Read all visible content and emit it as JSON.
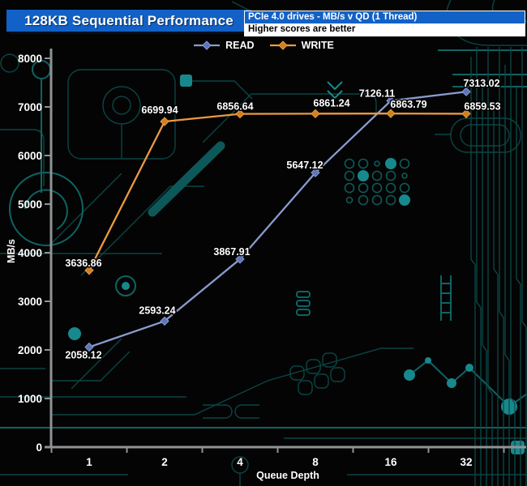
{
  "header": {
    "title": "128KB Sequential Performance",
    "subtitle": "PCIe 4.0 drives - MB/s v QD (1 Thread)",
    "note": "Higher scores are better"
  },
  "colors": {
    "header_blue": "#1261c7",
    "axis": "#8f9396",
    "tick_text": "#ffffff",
    "circuit_dim": "#0b4a4a",
    "circuit_bright": "#17898c"
  },
  "chart_data": {
    "type": "line",
    "title": "128KB Sequential Performance",
    "xlabel": "Queue Depth",
    "ylabel": "MB/s",
    "categories": [
      "1",
      "2",
      "4",
      "8",
      "16",
      "32"
    ],
    "yticks": [
      0,
      1000,
      2000,
      3000,
      4000,
      5000,
      6000,
      7000,
      8000
    ],
    "ylim": [
      0,
      8000
    ],
    "grid": false,
    "legend_position": "top",
    "series": [
      {
        "name": "READ",
        "color": "#8a9bcd",
        "marker_color": "#5d76bb",
        "values": [
          2058.12,
          2593.24,
          3867.91,
          5647.12,
          7126.11,
          7313.02
        ]
      },
      {
        "name": "WRITE",
        "color": "#ea9a41",
        "marker_color": "#d0801f",
        "values": [
          3636.86,
          6699.94,
          6856.64,
          6861.24,
          6863.79,
          6859.53
        ]
      }
    ]
  }
}
